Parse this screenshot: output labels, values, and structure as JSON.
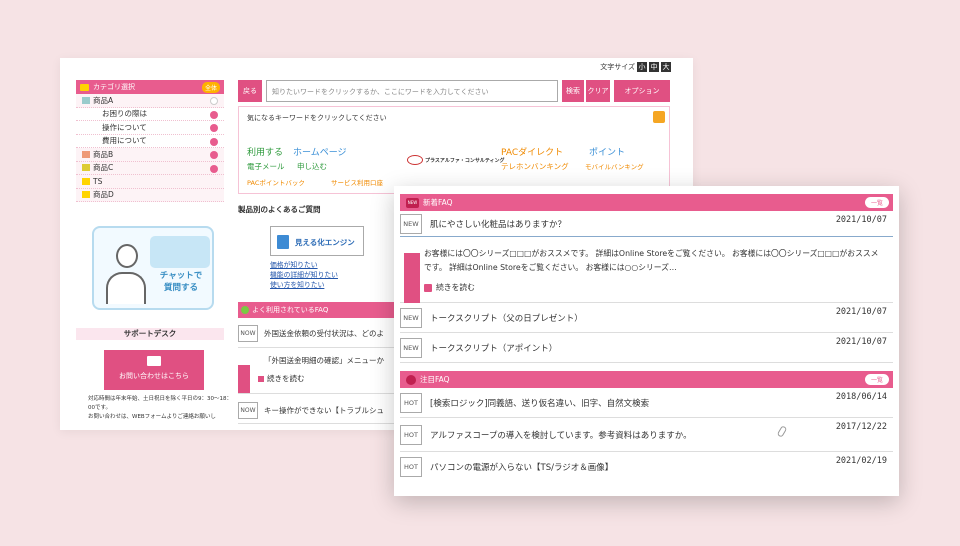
{
  "font_size": {
    "label": "文字サイズ",
    "small": "小",
    "medium": "中",
    "large": "大"
  },
  "sidebar": {
    "header": "カテゴリ選択",
    "all_badge": "全体",
    "items": [
      {
        "label": "商品A",
        "sub": false
      },
      {
        "label": "お困りの際は",
        "sub": true
      },
      {
        "label": "操作について",
        "sub": true
      },
      {
        "label": "費用について",
        "sub": true
      },
      {
        "label": "商品B",
        "sub": false
      },
      {
        "label": "商品C",
        "sub": false
      },
      {
        "label": "TS",
        "sub": false
      },
      {
        "label": "商品D",
        "sub": false
      }
    ]
  },
  "chat": {
    "line1": "チャットで",
    "line2": "質問する"
  },
  "support": {
    "title": "サポートデスク",
    "contact_label": "お問い合わせはこちら",
    "note1": "対応時間は年末年始、土日祝日を除く平日の9：30〜18：00です。",
    "note2": "お問い合わせは、WEBフォームよりご連絡お願いし"
  },
  "search": {
    "back": "戻る",
    "placeholder": "知りたいワードをクリックするか、ここにワードを入力してください",
    "search": "検索",
    "clear": "クリア",
    "option": "オプション"
  },
  "keywords": {
    "title": "気になるキーワードをクリックしてください",
    "k1": "利用する",
    "k2": "ホームページ",
    "k3": "電子メール",
    "k4": "申し込む",
    "k5": "PACポイントバック",
    "k6": "サービス利用口座",
    "k7": "PACダイレクト",
    "k8": "ポイント",
    "k9": "テレホンバンキング",
    "k10": "モバイルバンキング",
    "logo": "プラスアルファ・コンサルティング"
  },
  "product_faq": {
    "title": "製品別のよくあるご質問",
    "engine": "見える化エンジン",
    "links": [
      "価格が知りたい",
      "機能の詳細が知りたい",
      "使い方を知りたい"
    ]
  },
  "popular": {
    "title": "よく利用されているFAQ",
    "rows": [
      {
        "tag": "NOW",
        "text": "外国送金依頼の受付状況は、どのよ"
      },
      {
        "tag": "",
        "text": "「外国送金明細の確認」メニューか"
      },
      {
        "tag": "",
        "text": "続きを読む"
      },
      {
        "tag": "NOW",
        "text": "キー操作ができない【トラブルシュ"
      }
    ]
  },
  "new_faq": {
    "title": "新着FAQ",
    "badge": "NEW",
    "list_btn": "一覧",
    "rows": [
      {
        "tag": "NEW",
        "text": "肌にやさしい化粧品はありますか？",
        "date": "2021/10/07"
      }
    ],
    "expanded": "お客様には〇〇シリーズ□□□がおススメです。 詳細はOnline Storeをご覧ください。 お客様には〇〇シリーズ□□□がおススメです。 詳細はOnline Storeをご覧ください。 お客様には○○シリーズ…",
    "more": "続きを読む",
    "rows2": [
      {
        "tag": "NEW",
        "text": "トークスクリプト（父の日プレゼント）",
        "date": "2021/10/07"
      },
      {
        "tag": "NEW",
        "text": "トークスクリプト（アポイント）",
        "date": "2021/10/07"
      }
    ]
  },
  "hot_faq": {
    "title": "注目FAQ",
    "list_btn": "一覧",
    "rows": [
      {
        "tag": "HOT",
        "text": "[検索ロジック]同義語、送り仮名違い、旧字、自然文検索",
        "date": "2018/06/14"
      },
      {
        "tag": "HOT",
        "text": "アルファスコープの導入を検討しています。参考資料はありますか。",
        "date": "2017/12/22"
      },
      {
        "tag": "HOT",
        "text": "パソコンの電源が入らない【TS/ラジオ＆画像】",
        "date": "2021/02/19"
      }
    ]
  },
  "colors": {
    "accent": "#e85c8e",
    "background": "#f6e3e5"
  }
}
